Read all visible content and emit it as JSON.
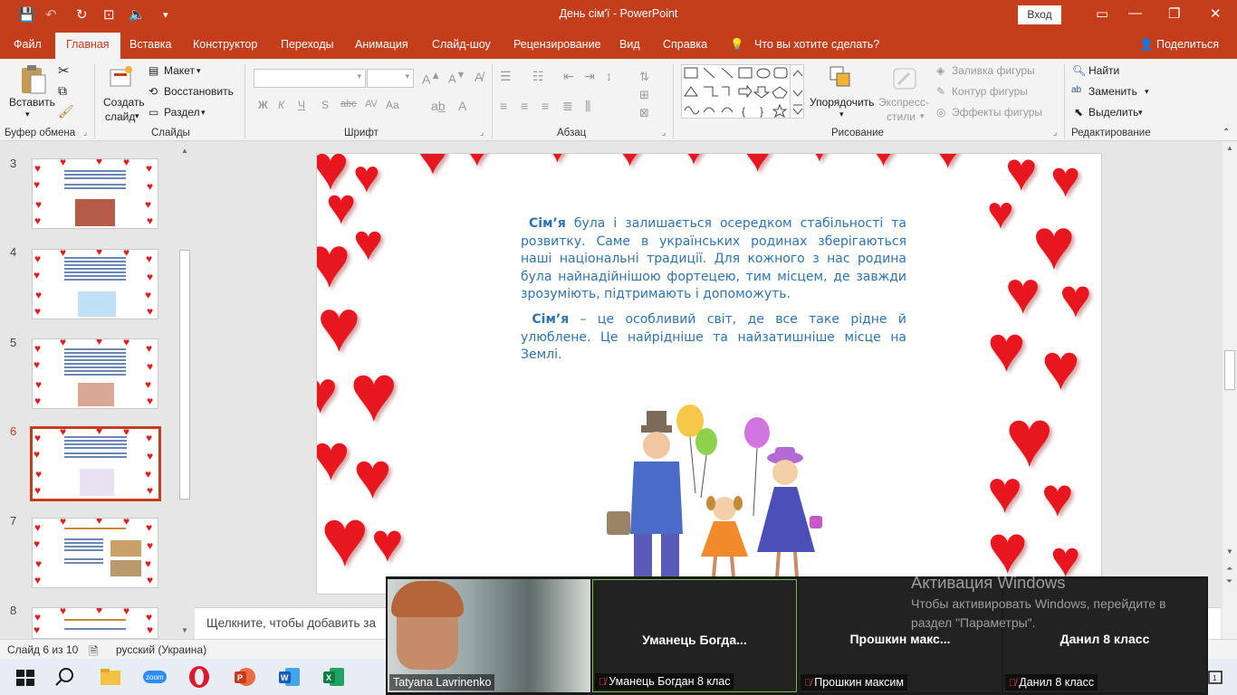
{
  "app": {
    "window_title": "День сім'ї  -  PowerPoint",
    "sign_in": "Вход"
  },
  "tabs": [
    {
      "label": "Файл"
    },
    {
      "label": "Главная",
      "active": true
    },
    {
      "label": "Вставка"
    },
    {
      "label": "Конструктор"
    },
    {
      "label": "Переходы"
    },
    {
      "label": "Анимация"
    },
    {
      "label": "Слайд-шоу"
    },
    {
      "label": "Рецензирование"
    },
    {
      "label": "Вид"
    },
    {
      "label": "Справка"
    }
  ],
  "tell_me": "Что вы хотите сделать?",
  "share": "Поделиться",
  "ribbon": {
    "clipboard": {
      "paste": "Вставить",
      "group": "Буфер обмена"
    },
    "slides": {
      "new_slide_1": "Создать",
      "new_slide_2": "слайд",
      "layout": "Макет",
      "reset": "Восстановить",
      "section": "Раздел",
      "group": "Слайды"
    },
    "font": {
      "group": "Шрифт",
      "bold": "Ж",
      "italic": "К",
      "underline": "Ч",
      "shadow": "S",
      "strike": "abc",
      "spacing": "AV",
      "case": "Aa",
      "color": "A"
    },
    "paragraph": {
      "group": "Абзац"
    },
    "drawing": {
      "arrange_1": "Упорядочить",
      "quick_styles_1": "Экспресс-",
      "quick_styles_2": "стили",
      "fill": "Заливка фигуры",
      "outline": "Контур фигуры",
      "effects": "Эффекты фигуры",
      "group": "Рисование"
    },
    "editing": {
      "find": "Найти",
      "replace": "Заменить",
      "select": "Выделить",
      "group": "Редактирование"
    }
  },
  "slides": [
    {
      "number": "3"
    },
    {
      "number": "4"
    },
    {
      "number": "5"
    },
    {
      "number": "6",
      "active": true
    },
    {
      "number": "7"
    },
    {
      "number": "8"
    }
  ],
  "slide_content": {
    "p1_bold": "Сім’я",
    "p1_text": " була і залишається осередком стабільності та розвитку. Саме в українських родинах зберігаються наші національні традиції. Для кожного з нас родина була найнадійнішою фортецею, тим місцем, де завжди зрозуміють, підтримають і допоможуть.",
    "p2_bold": "Сім’я",
    "p2_text": " – це особливий світ, де все таке рідне й улюблене. Це найрідніше та найзатишніше місце на Землі."
  },
  "notes_placeholder": "Щелкните, чтобы добавить за",
  "status": {
    "slide_of": "Слайд 6 из 10",
    "language": "русский (Украина)"
  },
  "zoom": {
    "participants": [
      {
        "label": "Tatyana Lavrinenko",
        "big": "",
        "muted": false
      },
      {
        "label": "Уманець Богдан 8 клас",
        "big": "Уманець  Богда...",
        "muted": true
      },
      {
        "label": "Прошкин максим",
        "big": "Прошкин  макс...",
        "muted": true
      },
      {
        "label": "Данил 8 класс",
        "big": "Данил 8 класс",
        "muted": true
      }
    ]
  },
  "activation": {
    "title": "Активация Windows",
    "text": "Чтобы активировать Windows, перейдите в раздел \"Параметры\"."
  },
  "colors": {
    "accent": "#c43e1c",
    "slide_text": "#2e74b5",
    "heart": "#e8161e"
  }
}
